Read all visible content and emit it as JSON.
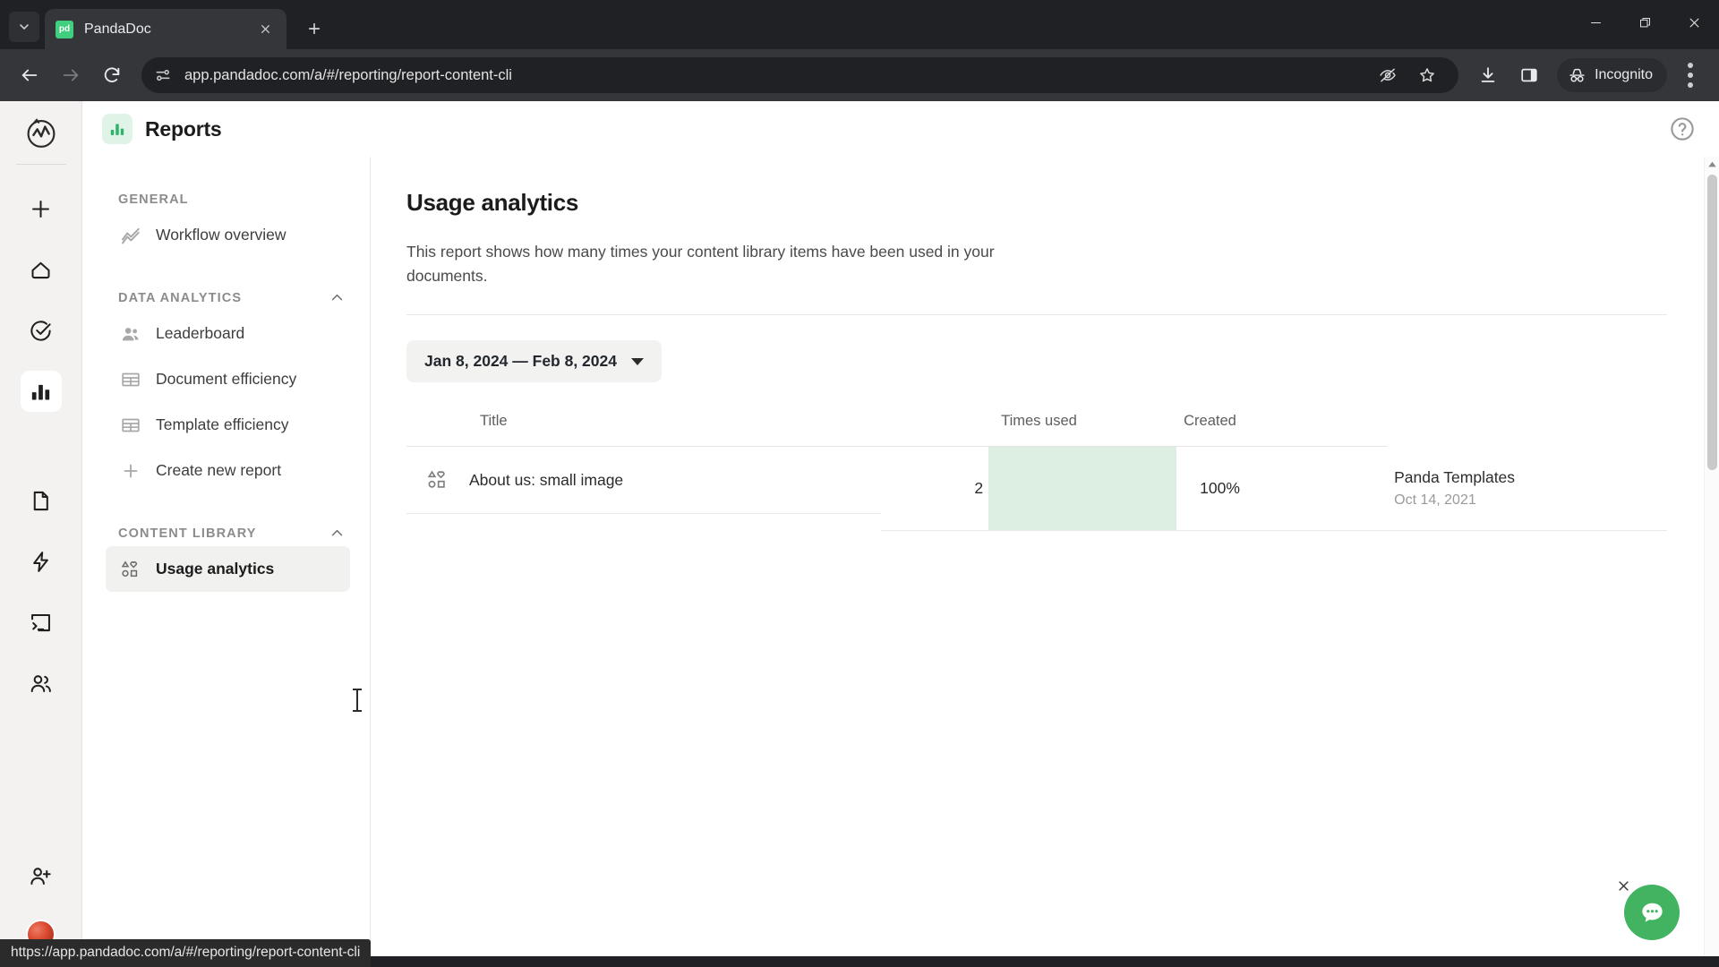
{
  "browser": {
    "tab": {
      "title": "PandaDoc",
      "favicon_label": "pd",
      "favicon_color": "#3fcf7f"
    },
    "new_tab_tooltip": "New tab",
    "url": "app.pandadoc.com/a/#/reporting/report-content-cli",
    "profile_label": "Incognito",
    "status_url": "https://app.pandadoc.com/a/#/reporting/report-content-cli"
  },
  "app": {
    "title": "Reports",
    "rail": {
      "logo_name": "pandadoc-logo-icon",
      "items": [
        {
          "name": "create-new-icon",
          "label": "Create new"
        },
        {
          "name": "home-icon",
          "label": "Home"
        },
        {
          "name": "tasks-icon",
          "label": "Tasks"
        },
        {
          "name": "reports-icon",
          "label": "Reports",
          "active": true
        },
        {
          "name": "documents-icon",
          "label": "Documents"
        },
        {
          "name": "automations-icon",
          "label": "Automations"
        },
        {
          "name": "templates-icon",
          "label": "Templates"
        },
        {
          "name": "contacts-icon",
          "label": "Contacts"
        }
      ],
      "bottom": [
        {
          "name": "invite-user-icon",
          "label": "Invite people"
        },
        {
          "name": "avatar",
          "label": "Account"
        }
      ]
    }
  },
  "nav": {
    "sections": [
      {
        "label": "GENERAL",
        "collapsible": false,
        "items": [
          {
            "label": "Workflow overview",
            "icon": "trend-line-icon",
            "active": false
          }
        ]
      },
      {
        "label": "DATA ANALYTICS",
        "collapsible": true,
        "items": [
          {
            "label": "Leaderboard",
            "icon": "people-icon",
            "active": false
          },
          {
            "label": "Document efficiency",
            "icon": "table-icon",
            "active": false
          },
          {
            "label": "Template efficiency",
            "icon": "table-icon",
            "active": false
          },
          {
            "label": "Create new report",
            "icon": "plus-icon",
            "active": false
          }
        ]
      },
      {
        "label": "CONTENT LIBRARY",
        "collapsible": true,
        "items": [
          {
            "label": "Usage analytics",
            "icon": "content-library-icon",
            "active": true
          }
        ]
      }
    ]
  },
  "main": {
    "heading": "Usage analytics",
    "description": "This report shows how many times your content library items have been used in your documents.",
    "date_range": "Jan 8, 2024 — Feb 8, 2024",
    "table": {
      "columns": [
        "Title",
        "Times used",
        "Created"
      ],
      "rows": [
        {
          "icon": "content-library-icon",
          "title": "About us: small image",
          "times_used": "2",
          "bar_percent": 100,
          "percent_label": "100%",
          "created_by": "Panda Templates",
          "created_date": "Oct 14, 2021"
        }
      ]
    }
  },
  "chat": {
    "icon": "chat-bubble-icon",
    "close_icon": "close-icon",
    "color": "#41b361"
  },
  "colors": {
    "accent_green": "#41b361",
    "bar_green": "#ddeee2",
    "badge_green": "#dff3e6"
  }
}
